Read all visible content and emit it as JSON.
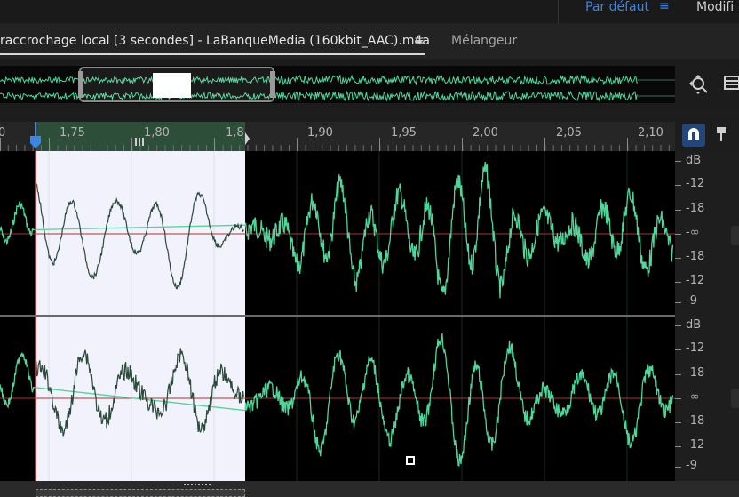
{
  "workspace": {
    "label": "Par défaut",
    "menu_glyph": "≡",
    "next_label": "Modifi"
  },
  "tabs": {
    "editor_label": "raccrochage local [3 secondes] - LaBanqueMedia (160kbit_AAC).m4a",
    "editor_menu_glyph": "≡",
    "mixer_label": "Mélangeur"
  },
  "ruler": {
    "ticks": [
      "0",
      "1,75",
      "1,80",
      "1,8",
      "1,90",
      "1,95",
      "2,00",
      "2,05",
      "2,10"
    ]
  },
  "db_scale": {
    "top_channel": [
      "dB",
      "-12",
      "-18",
      "-∞",
      "-18",
      "-12",
      "-9"
    ],
    "bottom_channel": [
      "dB",
      "-12",
      "-18",
      "-∞",
      "-18",
      "-12",
      "-9"
    ]
  },
  "icons": {
    "zoom": "zoom-icon",
    "list": "list-icon",
    "snap": "magnet-icon",
    "pin": "pin-icon"
  },
  "colors": {
    "waveform": "#4fd69a",
    "selected_waveform": "#2b4a3a",
    "accent": "#3c86e6"
  }
}
